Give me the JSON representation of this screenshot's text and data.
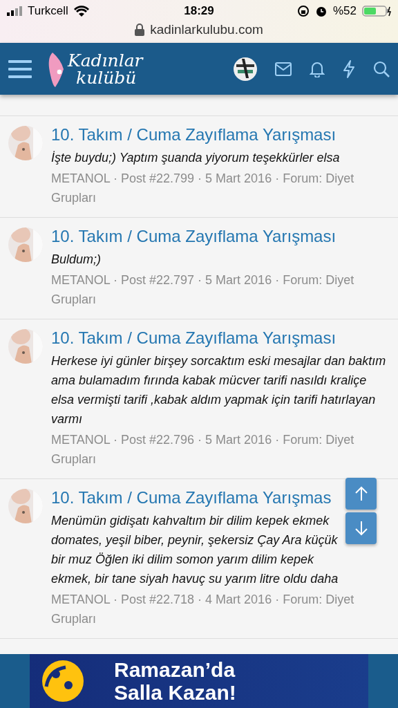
{
  "status_bar": {
    "carrier": "Turkcell",
    "time": "18:29",
    "battery": "%52"
  },
  "address_bar": {
    "url": "kadinlarkulubu.com"
  },
  "header": {
    "logo_lines": [
      "Kadınlar",
      "kulübü"
    ]
  },
  "posts": [
    {
      "title": "10. Takım / Cuma Zayıflama Yarışması",
      "body": "İşte buydu;) Yaptım şuanda yiyorum teşekkürler elsa",
      "meta": "METANOL · Post #22.799 · 5 Mart 2016 · Forum: Diyet Grupları"
    },
    {
      "title": "10. Takım / Cuma Zayıflama Yarışması",
      "body": "Buldum;)",
      "meta": "METANOL · Post #22.797 · 5 Mart 2016 · Forum: Diyet Grupları"
    },
    {
      "title": "10. Takım / Cuma Zayıflama Yarışması",
      "body": "Herkese iyi günler birşey sorcaktım eski mesajlar dan baktım ama bulamadım fırında kabak mücver tarifi nasıldı kraliçe elsa vermişti tarifi ,kabak aldım yapmak için tarifi hatırlayan varmı",
      "meta": "METANOL · Post #22.796 · 5 Mart 2016 · Forum: Diyet Grupları"
    },
    {
      "title": "10. Takım / Cuma Zayıflama Yarışmas",
      "body": "Menümün gidişatı kahvaltım bir dilim kepek ekmek domates, yeşil biber, peynir, şekersiz Çay Ara küçük bir muz Öğlen iki dilim somon yarım dilim kepek ekmek, bir tane siyah havuç su yarım litre oldu daha",
      "meta": "METANOL · Post #22.718 · 4 Mart 2016 · Forum: Diyet Grupları"
    }
  ],
  "banner": {
    "lines": [
      "Ramazan’da",
      "Salla Kazan!"
    ]
  }
}
